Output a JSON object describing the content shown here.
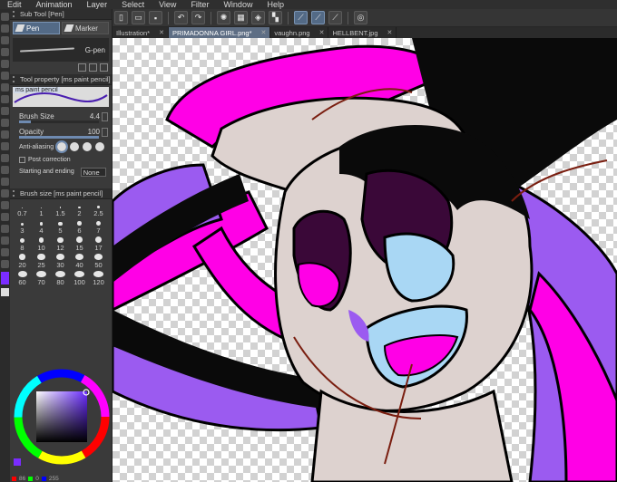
{
  "menu": [
    "Edit",
    "Animation",
    "Layer",
    "Select",
    "View",
    "Filter",
    "Window",
    "Help"
  ],
  "subtool": {
    "header": "Sub Tool [Pen]",
    "tabs": [
      "Pen",
      "Marker"
    ],
    "brush_name": "G-pen"
  },
  "tool_property": {
    "header": "Tool property [ms paint pencil]",
    "brush_label": "ms paint pencil",
    "brush_size_label": "Brush Size",
    "brush_size_value": "4.4",
    "brush_size_fraction": 0.15,
    "opacity_label": "Opacity",
    "opacity_value": "100",
    "opacity_fraction": 1.0,
    "antialias_label": "Anti-aliasing",
    "post_correction_label": "Post correction",
    "starting_ending_label": "Starting and ending",
    "starting_ending_value": "None"
  },
  "brush_size_panel": {
    "header": "Brush size [ms paint pencil]",
    "sizes": [
      "0.7",
      "1",
      "1.5",
      "2",
      "2.5",
      "3",
      "4",
      "5",
      "6",
      "7",
      "8",
      "10",
      "12",
      "15",
      "17",
      "20",
      "25",
      "30",
      "40",
      "50",
      "60",
      "70",
      "80",
      "100",
      "120"
    ]
  },
  "color": {
    "main": "#7a2cff",
    "values": [
      "86",
      "0",
      "255"
    ]
  },
  "file_tabs": [
    {
      "label": "Illustration*",
      "active": false
    },
    {
      "label": "PRIMADONNA GIRL.png*",
      "active": true
    },
    {
      "label": "vaughn.png",
      "active": false
    },
    {
      "label": "HELLBENT.jpg",
      "active": false
    }
  ],
  "colors": {
    "accent": "#536a86",
    "skin": "#ddd2cf",
    "hair_black": "#0a0a0a",
    "hair_purple": "#9b5bf0",
    "hair_magenta": "#ff00e6",
    "eye_dark": "#3a0838",
    "iris_blue": "#a9d7f4",
    "sketch_line": "#7a1e10"
  }
}
